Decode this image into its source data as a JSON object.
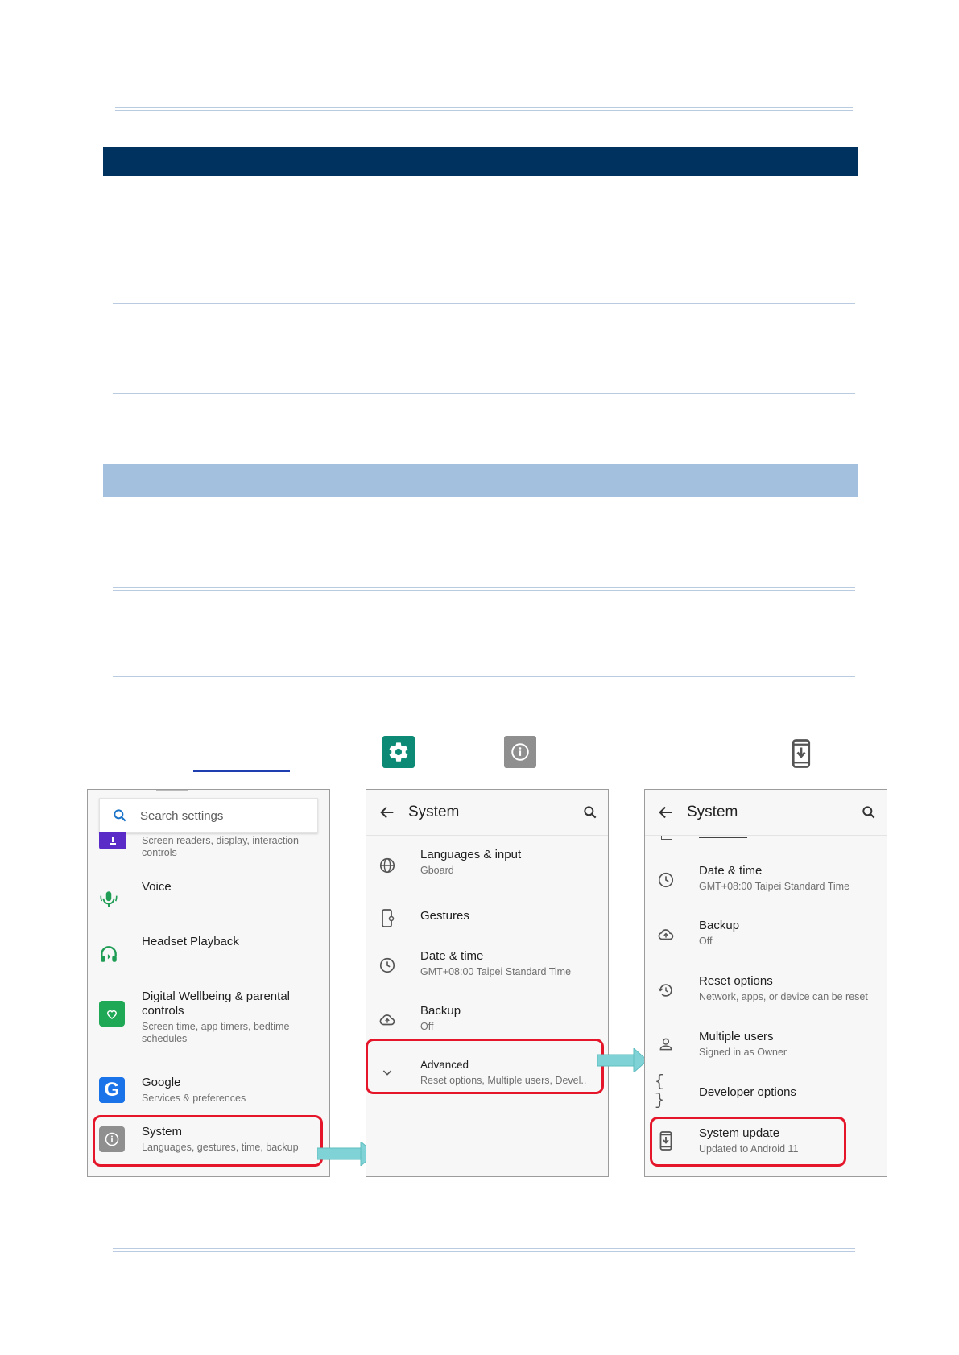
{
  "panel1": {
    "search_placeholder": "Search settings",
    "items": [
      {
        "title": "",
        "subtitle": "Screen readers, display, interaction controls"
      },
      {
        "title": "Voice",
        "subtitle": ""
      },
      {
        "title": "Headset Playback",
        "subtitle": ""
      },
      {
        "title": "Digital Wellbeing & parental controls",
        "subtitle": "Screen time, app timers, bedtime schedules"
      },
      {
        "title": "Google",
        "subtitle": "Services & preferences"
      },
      {
        "title": "System",
        "subtitle": "Languages, gestures, time, backup"
      }
    ]
  },
  "panel2": {
    "title": "System",
    "items": [
      {
        "title": "Languages & input",
        "subtitle": "Gboard"
      },
      {
        "title": "Gestures",
        "subtitle": ""
      },
      {
        "title": "Date & time",
        "subtitle": "GMT+08:00 Taipei Standard Time"
      },
      {
        "title": "Backup",
        "subtitle": "Off"
      },
      {
        "title": "Advanced",
        "subtitle": "Reset options, Multiple users, Devel.."
      }
    ]
  },
  "panel3": {
    "title": "System",
    "items": [
      {
        "title": "Date & time",
        "subtitle": "GMT+08:00 Taipei Standard Time"
      },
      {
        "title": "Backup",
        "subtitle": "Off"
      },
      {
        "title": "Reset options",
        "subtitle": "Network, apps, or device can be reset"
      },
      {
        "title": "Multiple users",
        "subtitle": "Signed in as Owner"
      },
      {
        "title": "Developer options",
        "subtitle": ""
      },
      {
        "title": "System update",
        "subtitle": "Updated to Android 11"
      }
    ]
  },
  "colors": {
    "header_band": "#00325f",
    "sub_band": "#a4c0df",
    "highlight": "#e5162a",
    "arrow": "#7fd3d6"
  },
  "icons": [
    "settings-icon",
    "info-icon",
    "system-update-icon",
    "search-icon",
    "back-arrow-icon"
  ]
}
